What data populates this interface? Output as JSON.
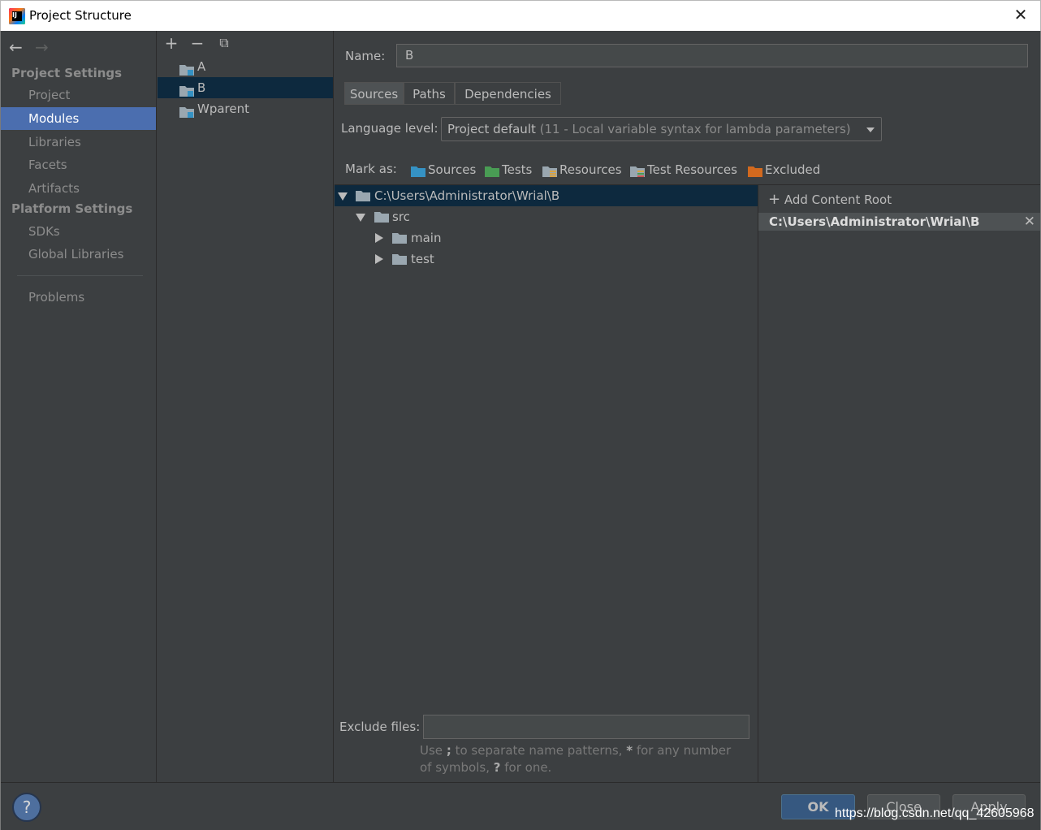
{
  "window": {
    "title": "Project Structure"
  },
  "nav": {
    "back_icon": "←",
    "forward_icon": "→",
    "project_settings_header": "Project Settings",
    "items_ps": [
      {
        "label": "Project"
      },
      {
        "label": "Modules"
      },
      {
        "label": "Libraries"
      },
      {
        "label": "Facets"
      },
      {
        "label": "Artifacts"
      }
    ],
    "platform_settings_header": "Platform Settings",
    "items_pl": [
      {
        "label": "SDKs"
      },
      {
        "label": "Global Libraries"
      }
    ],
    "problems": "Problems",
    "selected": "Modules"
  },
  "modules": {
    "toolbar": {
      "add": "+",
      "remove": "−",
      "copy": "⧉"
    },
    "items": [
      {
        "label": "A"
      },
      {
        "label": "B"
      },
      {
        "label": "Wparent"
      }
    ],
    "selected": "B"
  },
  "detail": {
    "name_label": "Name:",
    "name_value": "B",
    "tabs": [
      {
        "label": "Sources"
      },
      {
        "label": "Paths"
      },
      {
        "label": "Dependencies"
      }
    ],
    "active_tab": "Sources",
    "language_level_label": "Language level:",
    "language_level_value": "Project default",
    "language_level_hint": "(11 - Local variable syntax for lambda parameters)",
    "mark_as_label": "Mark as:",
    "mark_as": [
      {
        "label": "Sources",
        "color": "#3592c4"
      },
      {
        "label": "Tests",
        "color": "#499c54"
      },
      {
        "label": "Resources",
        "color": "#9aa7b0"
      },
      {
        "label": "Test Resources",
        "color": "#9aa7b0"
      },
      {
        "label": "Excluded",
        "color": "#d2691e"
      }
    ],
    "tree": [
      {
        "label": "C:\\Users\\Administrator\\Wrial\\B",
        "expanded": true
      },
      {
        "label": "src",
        "expanded": true
      },
      {
        "label": "main",
        "expanded": false
      },
      {
        "label": "test",
        "expanded": false
      }
    ],
    "add_content_root": "Add Content Root",
    "content_root": "C:\\Users\\Administrator\\Wrial\\B",
    "exclude_files_label": "Exclude files:",
    "exclude_files_value": "",
    "exclude_hint_1": "Use",
    "exclude_hint_sep": ";",
    "exclude_hint_2": "to separate name patterns,",
    "exclude_hint_star": "*",
    "exclude_hint_3": "for any number of symbols,",
    "exclude_hint_q": "?",
    "exclude_hint_4": "for one."
  },
  "footer": {
    "help": "?",
    "ok": "OK",
    "close": "Close",
    "apply": "Apply",
    "watermark": "https://blog.csdn.net/qq_42605968"
  },
  "colors": {
    "background": "#3c3f41",
    "selection": "#4b6eaf",
    "tree_selection": "#0d293e"
  }
}
